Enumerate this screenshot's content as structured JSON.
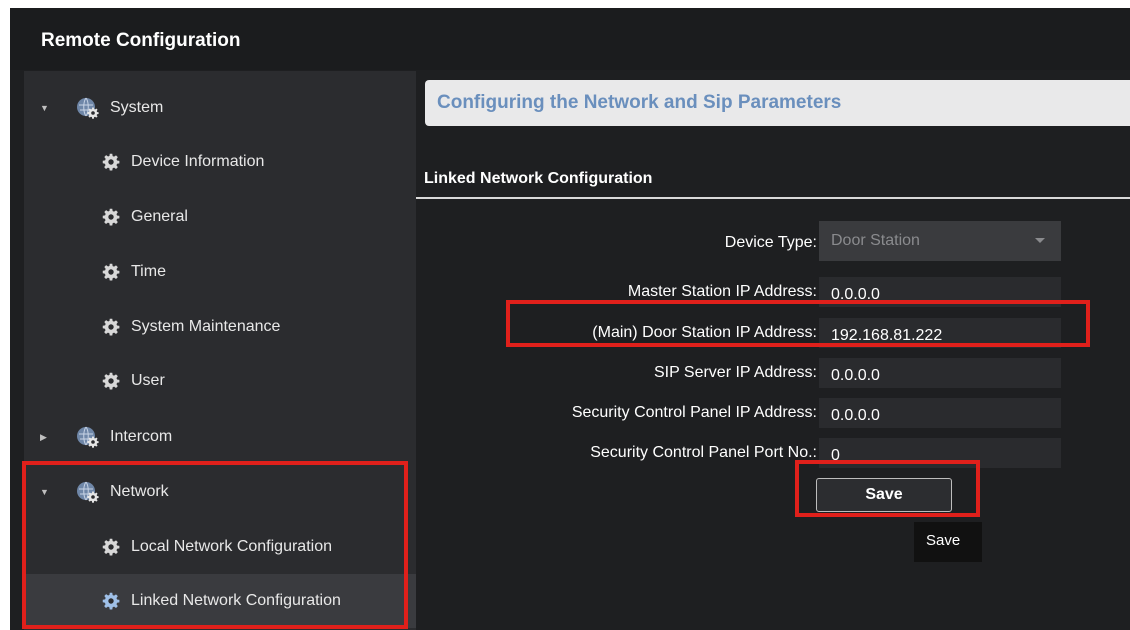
{
  "window": {
    "title": "Remote Configuration"
  },
  "sidebar": {
    "groups": [
      {
        "label": "System",
        "expanded": true,
        "children": [
          {
            "label": "Device Information"
          },
          {
            "label": "General"
          },
          {
            "label": "Time"
          },
          {
            "label": "System Maintenance"
          },
          {
            "label": "User"
          }
        ]
      },
      {
        "label": "Intercom",
        "expanded": false,
        "children": []
      },
      {
        "label": "Network",
        "expanded": true,
        "children": [
          {
            "label": "Local Network Configuration"
          },
          {
            "label": "Linked Network Configuration",
            "selected": true
          }
        ]
      }
    ]
  },
  "main": {
    "header": "Configuring the Network and Sip Parameters",
    "section_title": "Linked Network Configuration",
    "fields": {
      "device_type": {
        "label": "Device Type:",
        "value": "Door Station"
      },
      "master_station_ip": {
        "label": "Master Station IP Address:",
        "value": "0.0.0.0"
      },
      "main_door_station_ip": {
        "label": "(Main) Door Station IP Address:",
        "value": "192.168.81.222"
      },
      "sip_server_ip": {
        "label": "SIP Server IP Address:",
        "value": "0.0.0.0"
      },
      "security_panel_ip": {
        "label": "Security Control Panel IP Address:",
        "value": "0.0.0.0"
      },
      "security_panel_port": {
        "label": "Security Control Panel Port No.:",
        "value": "0"
      }
    },
    "save_label": "Save",
    "tooltip": "Save"
  },
  "colors": {
    "highlight": "#e0201b",
    "header_text": "#6a8fbd",
    "panel_bg": "#1e1f21",
    "sidebar_bg": "#2b2c2f"
  },
  "icons": {
    "group": "gear-globe-icon",
    "child": "gear-icon",
    "expanded": "triangle-down-icon",
    "collapsed": "triangle-right-icon"
  }
}
